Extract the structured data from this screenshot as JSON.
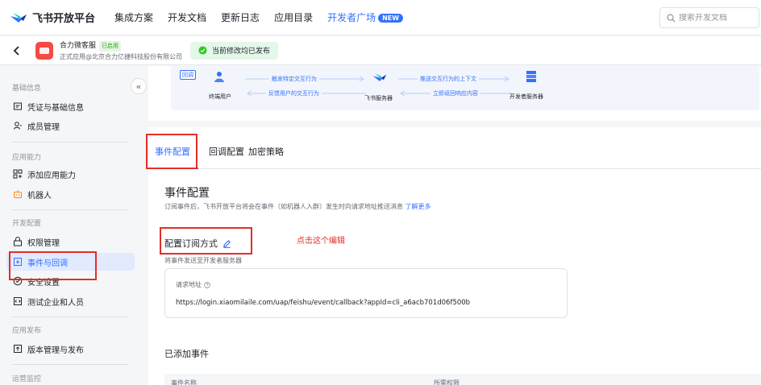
{
  "topnav": {
    "logo_text": "飞书开放平台",
    "links": [
      "集成方案",
      "开发文档",
      "更新日志",
      "应用目录"
    ],
    "dev_square": "开发者广场",
    "new_badge": "NEW",
    "search_placeholder": "搜索开发文档"
  },
  "app": {
    "name": "合力微客服",
    "status_tag": "已启用",
    "org": "正式应用@北京合力亿捷科技股份有限公司",
    "publish_status": "当前修改均已发布"
  },
  "sidebar": {
    "groups": [
      {
        "label": "基础信息",
        "items": [
          "凭证与基础信息",
          "成员管理"
        ]
      },
      {
        "label": "应用能力",
        "items": [
          "添加应用能力",
          "机器人"
        ]
      },
      {
        "label": "开发配置",
        "items": [
          "权限管理",
          "事件与回调",
          "安全设置",
          "测试企业和人员"
        ]
      },
      {
        "label": "应用发布",
        "items": [
          "版本管理与发布"
        ]
      },
      {
        "label": "运营监控",
        "items": []
      }
    ],
    "collapse_icon": "«"
  },
  "flow": {
    "tag": "回调",
    "end_user": "终端用户",
    "feishu_server": "飞书服务器",
    "dev_server": "开发者服务器",
    "arrow1_top": "触发特定交互行为",
    "arrow1_bottom": "反馈用户的交互行为",
    "arrow2_top": "推送交互行为的上下文",
    "arrow2_bottom": "立即返回响应内容"
  },
  "tabs": [
    "事件配置",
    "回调配置",
    "加密策略"
  ],
  "event_config": {
    "title": "事件配置",
    "desc": "订阅事件后，飞书开放平台将会在事件（如机器人入群）发生时向请求地址推送消息",
    "learn_more": "了解更多",
    "subscribe_title": "配置订阅方式",
    "annotation": "点击这个编辑",
    "subscribe_desc": "将事件发送至开发者服务器",
    "url_label": "请求地址",
    "url_value": "https://login.xiaomilaile.com/uap/feishu/event/callback?appId=cli_a6acb701d06f500b",
    "added_title": "已添加事件",
    "col_event": "事件名称",
    "col_perm": "所需权限"
  },
  "colors": {
    "accent": "#3370ff",
    "annotation": "#e22e28",
    "success": "#2ea121"
  }
}
